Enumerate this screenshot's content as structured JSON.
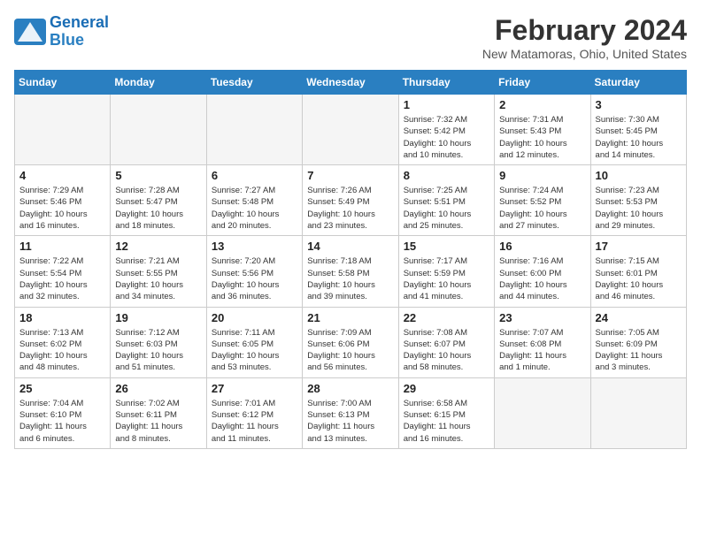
{
  "header": {
    "logo_line1": "General",
    "logo_line2": "Blue",
    "month_year": "February 2024",
    "location": "New Matamoras, Ohio, United States"
  },
  "days_of_week": [
    "Sunday",
    "Monday",
    "Tuesday",
    "Wednesday",
    "Thursday",
    "Friday",
    "Saturday"
  ],
  "weeks": [
    [
      {
        "day": "",
        "info": ""
      },
      {
        "day": "",
        "info": ""
      },
      {
        "day": "",
        "info": ""
      },
      {
        "day": "",
        "info": ""
      },
      {
        "day": "1",
        "info": "Sunrise: 7:32 AM\nSunset: 5:42 PM\nDaylight: 10 hours\nand 10 minutes."
      },
      {
        "day": "2",
        "info": "Sunrise: 7:31 AM\nSunset: 5:43 PM\nDaylight: 10 hours\nand 12 minutes."
      },
      {
        "day": "3",
        "info": "Sunrise: 7:30 AM\nSunset: 5:45 PM\nDaylight: 10 hours\nand 14 minutes."
      }
    ],
    [
      {
        "day": "4",
        "info": "Sunrise: 7:29 AM\nSunset: 5:46 PM\nDaylight: 10 hours\nand 16 minutes."
      },
      {
        "day": "5",
        "info": "Sunrise: 7:28 AM\nSunset: 5:47 PM\nDaylight: 10 hours\nand 18 minutes."
      },
      {
        "day": "6",
        "info": "Sunrise: 7:27 AM\nSunset: 5:48 PM\nDaylight: 10 hours\nand 20 minutes."
      },
      {
        "day": "7",
        "info": "Sunrise: 7:26 AM\nSunset: 5:49 PM\nDaylight: 10 hours\nand 23 minutes."
      },
      {
        "day": "8",
        "info": "Sunrise: 7:25 AM\nSunset: 5:51 PM\nDaylight: 10 hours\nand 25 minutes."
      },
      {
        "day": "9",
        "info": "Sunrise: 7:24 AM\nSunset: 5:52 PM\nDaylight: 10 hours\nand 27 minutes."
      },
      {
        "day": "10",
        "info": "Sunrise: 7:23 AM\nSunset: 5:53 PM\nDaylight: 10 hours\nand 29 minutes."
      }
    ],
    [
      {
        "day": "11",
        "info": "Sunrise: 7:22 AM\nSunset: 5:54 PM\nDaylight: 10 hours\nand 32 minutes."
      },
      {
        "day": "12",
        "info": "Sunrise: 7:21 AM\nSunset: 5:55 PM\nDaylight: 10 hours\nand 34 minutes."
      },
      {
        "day": "13",
        "info": "Sunrise: 7:20 AM\nSunset: 5:56 PM\nDaylight: 10 hours\nand 36 minutes."
      },
      {
        "day": "14",
        "info": "Sunrise: 7:18 AM\nSunset: 5:58 PM\nDaylight: 10 hours\nand 39 minutes."
      },
      {
        "day": "15",
        "info": "Sunrise: 7:17 AM\nSunset: 5:59 PM\nDaylight: 10 hours\nand 41 minutes."
      },
      {
        "day": "16",
        "info": "Sunrise: 7:16 AM\nSunset: 6:00 PM\nDaylight: 10 hours\nand 44 minutes."
      },
      {
        "day": "17",
        "info": "Sunrise: 7:15 AM\nSunset: 6:01 PM\nDaylight: 10 hours\nand 46 minutes."
      }
    ],
    [
      {
        "day": "18",
        "info": "Sunrise: 7:13 AM\nSunset: 6:02 PM\nDaylight: 10 hours\nand 48 minutes."
      },
      {
        "day": "19",
        "info": "Sunrise: 7:12 AM\nSunset: 6:03 PM\nDaylight: 10 hours\nand 51 minutes."
      },
      {
        "day": "20",
        "info": "Sunrise: 7:11 AM\nSunset: 6:05 PM\nDaylight: 10 hours\nand 53 minutes."
      },
      {
        "day": "21",
        "info": "Sunrise: 7:09 AM\nSunset: 6:06 PM\nDaylight: 10 hours\nand 56 minutes."
      },
      {
        "day": "22",
        "info": "Sunrise: 7:08 AM\nSunset: 6:07 PM\nDaylight: 10 hours\nand 58 minutes."
      },
      {
        "day": "23",
        "info": "Sunrise: 7:07 AM\nSunset: 6:08 PM\nDaylight: 11 hours\nand 1 minute."
      },
      {
        "day": "24",
        "info": "Sunrise: 7:05 AM\nSunset: 6:09 PM\nDaylight: 11 hours\nand 3 minutes."
      }
    ],
    [
      {
        "day": "25",
        "info": "Sunrise: 7:04 AM\nSunset: 6:10 PM\nDaylight: 11 hours\nand 6 minutes."
      },
      {
        "day": "26",
        "info": "Sunrise: 7:02 AM\nSunset: 6:11 PM\nDaylight: 11 hours\nand 8 minutes."
      },
      {
        "day": "27",
        "info": "Sunrise: 7:01 AM\nSunset: 6:12 PM\nDaylight: 11 hours\nand 11 minutes."
      },
      {
        "day": "28",
        "info": "Sunrise: 7:00 AM\nSunset: 6:13 PM\nDaylight: 11 hours\nand 13 minutes."
      },
      {
        "day": "29",
        "info": "Sunrise: 6:58 AM\nSunset: 6:15 PM\nDaylight: 11 hours\nand 16 minutes."
      },
      {
        "day": "",
        "info": ""
      },
      {
        "day": "",
        "info": ""
      }
    ]
  ]
}
